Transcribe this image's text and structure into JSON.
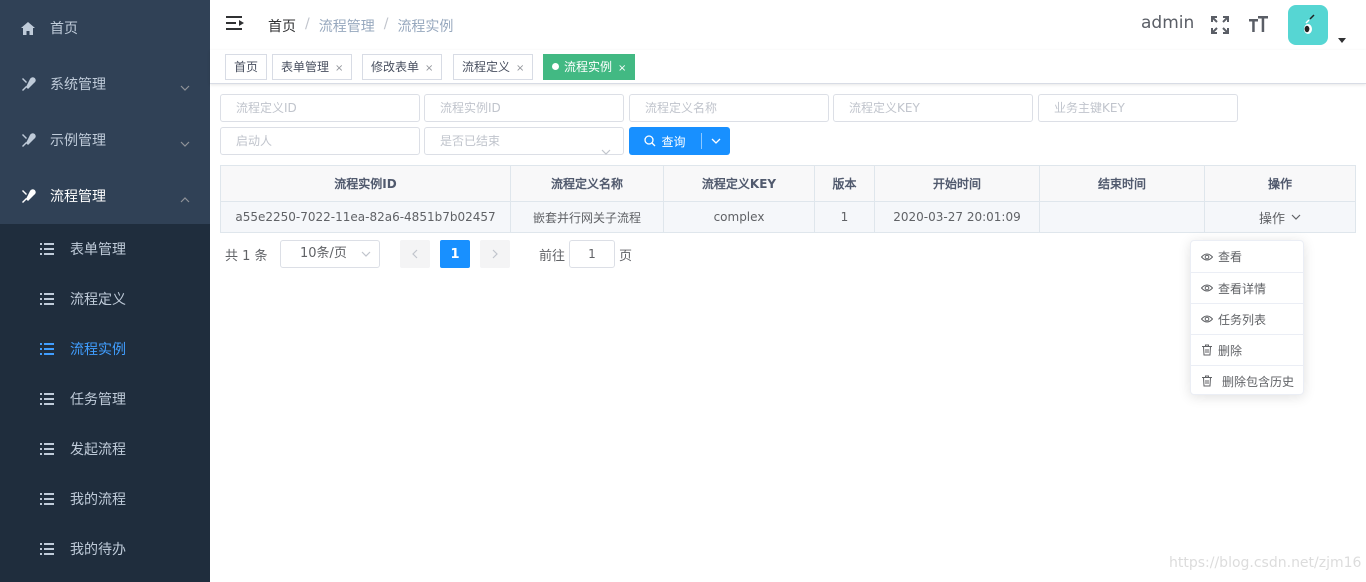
{
  "sidebar": {
    "items": [
      {
        "label": "首页",
        "icon": "home-icon"
      },
      {
        "label": "系统管理",
        "icon": "tools-icon"
      },
      {
        "label": "示例管理",
        "icon": "tools-icon"
      },
      {
        "label": "流程管理",
        "icon": "tools-icon"
      }
    ],
    "subitems": [
      {
        "label": "表单管理"
      },
      {
        "label": "流程定义"
      },
      {
        "label": "流程实例"
      },
      {
        "label": "任务管理"
      },
      {
        "label": "发起流程"
      },
      {
        "label": "我的流程"
      },
      {
        "label": "我的待办"
      }
    ]
  },
  "navbar": {
    "breadcrumb": [
      "首页",
      "流程管理",
      "流程实例"
    ],
    "separator": "/",
    "user": "admin"
  },
  "tags": [
    {
      "label": "首页"
    },
    {
      "label": "表单管理",
      "close": "×"
    },
    {
      "label": "修改表单",
      "close": "×"
    },
    {
      "label": "流程定义",
      "close": "×"
    },
    {
      "label": "流程实例",
      "close": "×",
      "active": true
    }
  ],
  "search": {
    "proc_def_id": "流程定义ID",
    "proc_inst_id": "流程实例ID",
    "proc_def_name": "流程定义名称",
    "proc_def_key": "流程定义KEY",
    "business_key": "业务主键KEY",
    "starter": "启动人",
    "finished": "是否已结束",
    "query_label": "查询"
  },
  "table": {
    "headers": [
      "流程实例ID",
      "流程定义名称",
      "流程定义KEY",
      "版本",
      "开始时间",
      "结束时间",
      "操作"
    ],
    "rows": [
      [
        "a55e2250-7022-11ea-82a6-4851b7b02457",
        "嵌套并行网关子流程",
        "complex",
        "1",
        "2020-03-27 20:01:09",
        "",
        "操作"
      ]
    ]
  },
  "pagination": {
    "total": "共 1 条",
    "page_size": "10条/页",
    "current": "1",
    "goto_label": "前往",
    "goto_value": "1",
    "page_suffix": "页"
  },
  "dropdown": {
    "items": [
      {
        "label": "查看",
        "icon": "eye-icon"
      },
      {
        "label": "查看详情",
        "icon": "eye-icon"
      },
      {
        "label": "任务列表",
        "icon": "eye-icon"
      },
      {
        "label": "删除",
        "icon": "trash-icon"
      },
      {
        "label": "删除包含历史",
        "icon": "trash-icon"
      }
    ]
  },
  "watermark": "https://blog.csdn.net/zjm16",
  "colors": {
    "sidebar_bg": "#304156",
    "submenu_bg": "#1f2d3d",
    "active_link": "#409eff",
    "active_tag": "#42b983",
    "primary_button": "#1890ff"
  }
}
